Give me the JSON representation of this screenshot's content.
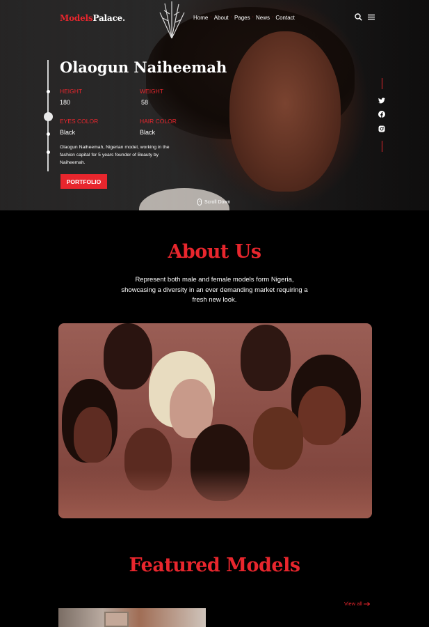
{
  "brand": {
    "part1": "Models",
    "part2": "Palace."
  },
  "nav": {
    "items": [
      "Home",
      "About",
      "Pages",
      "News",
      "Contact"
    ]
  },
  "hero": {
    "name": "Olaogun Naiheemah",
    "height_label": "HEIGHT",
    "height_value": "180",
    "weight_label": "WEIGHT",
    "weight_value": "58",
    "eyes_label": "EYES COLOR",
    "eyes_value": "Black",
    "hair_label": "HAIR COLOR",
    "hair_value": "Black",
    "bio": "Olaogun Naiheemah, Nigerian model, working in the fashion capital for 5 years founder of Beauty by Naiheemah.",
    "portfolio_button": "PORTFOLIO",
    "scroll_label": "Scroll Down"
  },
  "social": {
    "icons": [
      "twitter-icon",
      "facebook-icon",
      "instagram-icon"
    ]
  },
  "about": {
    "title": "About Us",
    "text": "Represent both male and female models form Nigeria, showcasing a diversity in an ever demanding market requiring a fresh new look."
  },
  "featured": {
    "title": "Featured Models",
    "view_all": "View all"
  },
  "colors": {
    "accent": "#e8262d",
    "background": "#000000"
  }
}
